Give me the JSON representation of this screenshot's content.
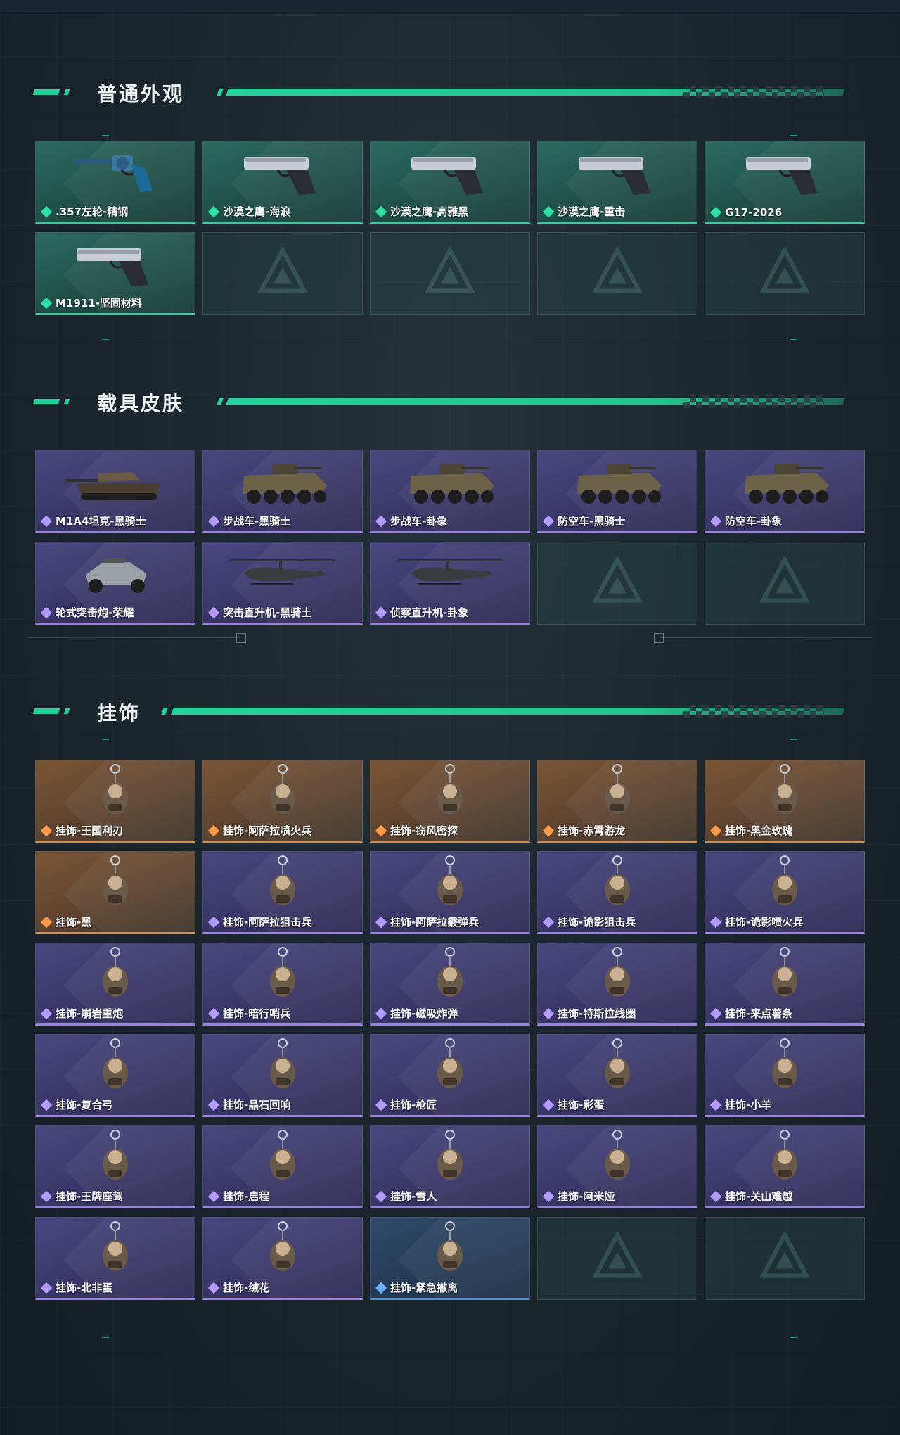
{
  "colors": {
    "accent": "#22d39a",
    "green_rarity": "#25d49b",
    "purple_rarity": "#9c7cf0",
    "orange_rarity": "#e08a40",
    "blue_rarity": "#4a90e0"
  },
  "sections": [
    {
      "title": "普通外观",
      "items": [
        {
          "label": ".357左轮-精钢",
          "rarity": "green",
          "icon": "revolver-icon"
        },
        {
          "label": "沙漠之鹰-海浪",
          "rarity": "green",
          "icon": "pistol-icon"
        },
        {
          "label": "沙漠之鹰-高雅黑",
          "rarity": "green",
          "icon": "pistol-icon"
        },
        {
          "label": "沙漠之鹰-重击",
          "rarity": "green",
          "icon": "pistol-icon"
        },
        {
          "label": "G17-2026",
          "rarity": "green",
          "icon": "pistol-icon"
        },
        {
          "label": "M1911-坚固材料",
          "rarity": "green",
          "icon": "pistol-icon"
        }
      ],
      "empty_slots": 4
    },
    {
      "title": "载具皮肤",
      "items": [
        {
          "label": "M1A4坦克-黑骑士",
          "rarity": "purple",
          "icon": "tank-icon"
        },
        {
          "label": "步战车-黑骑士",
          "rarity": "purple",
          "icon": "apc-icon"
        },
        {
          "label": "步战车-卦象",
          "rarity": "purple",
          "icon": "apc-icon"
        },
        {
          "label": "防空车-黑骑士",
          "rarity": "purple",
          "icon": "apc-icon"
        },
        {
          "label": "防空车-卦象",
          "rarity": "purple",
          "icon": "apc-icon"
        },
        {
          "label": "轮式突击炮-荣耀",
          "rarity": "purple",
          "icon": "buggy-icon"
        },
        {
          "label": "突击直升机-黑骑士",
          "rarity": "purple",
          "icon": "helicopter-icon"
        },
        {
          "label": "侦察直升机-卦象",
          "rarity": "purple",
          "icon": "helicopter-icon"
        }
      ],
      "empty_slots": 2
    },
    {
      "title": "挂饰",
      "items": [
        {
          "label": "挂饰-王国利刃",
          "rarity": "orange",
          "icon": "charm-icon"
        },
        {
          "label": "挂饰-阿萨拉喷火兵",
          "rarity": "orange",
          "icon": "charm-icon"
        },
        {
          "label": "挂饰-窃风密探",
          "rarity": "orange",
          "icon": "charm-icon"
        },
        {
          "label": "挂饰-赤霄游龙",
          "rarity": "orange",
          "icon": "charm-icon"
        },
        {
          "label": "挂饰-黑金玫瑰",
          "rarity": "orange",
          "icon": "charm-icon"
        },
        {
          "label": "挂饰-黑",
          "rarity": "orange",
          "icon": "charm-icon"
        },
        {
          "label": "挂饰-阿萨拉狙击兵",
          "rarity": "purple",
          "icon": "charm-icon"
        },
        {
          "label": "挂饰-阿萨拉霰弹兵",
          "rarity": "purple",
          "icon": "charm-icon"
        },
        {
          "label": "挂饰-诡影狙击兵",
          "rarity": "purple",
          "icon": "charm-icon"
        },
        {
          "label": "挂饰-诡影喷火兵",
          "rarity": "purple",
          "icon": "charm-icon"
        },
        {
          "label": "挂饰-崩岩重炮",
          "rarity": "purple",
          "icon": "charm-icon"
        },
        {
          "label": "挂饰-暗行哨兵",
          "rarity": "purple",
          "icon": "charm-icon"
        },
        {
          "label": "挂饰-磁吸炸弹",
          "rarity": "purple",
          "icon": "charm-icon"
        },
        {
          "label": "挂饰-特斯拉线圈",
          "rarity": "purple",
          "icon": "charm-icon"
        },
        {
          "label": "挂饰-来点薯条",
          "rarity": "purple",
          "icon": "charm-icon"
        },
        {
          "label": "挂饰-复合弓",
          "rarity": "purple",
          "icon": "charm-icon"
        },
        {
          "label": "挂饰-晶石回响",
          "rarity": "purple",
          "icon": "charm-icon"
        },
        {
          "label": "挂饰-枪匠",
          "rarity": "purple",
          "icon": "charm-icon"
        },
        {
          "label": "挂饰-彩蛋",
          "rarity": "purple",
          "icon": "charm-icon"
        },
        {
          "label": "挂饰-小羊",
          "rarity": "purple",
          "icon": "charm-icon"
        },
        {
          "label": "挂饰-王牌座驾",
          "rarity": "purple",
          "icon": "charm-icon"
        },
        {
          "label": "挂饰-启程",
          "rarity": "purple",
          "icon": "charm-icon"
        },
        {
          "label": "挂饰-雪人",
          "rarity": "purple",
          "icon": "charm-icon"
        },
        {
          "label": "挂饰-阿米娅",
          "rarity": "purple",
          "icon": "charm-icon"
        },
        {
          "label": "挂饰-关山难越",
          "rarity": "purple",
          "icon": "charm-icon"
        },
        {
          "label": "挂饰-北非蛋",
          "rarity": "purple",
          "icon": "charm-icon"
        },
        {
          "label": "挂饰-绒花",
          "rarity": "purple",
          "icon": "charm-icon"
        },
        {
          "label": "挂饰-紧急撤离",
          "rarity": "blue",
          "icon": "charm-icon"
        }
      ],
      "empty_slots": 2
    }
  ]
}
